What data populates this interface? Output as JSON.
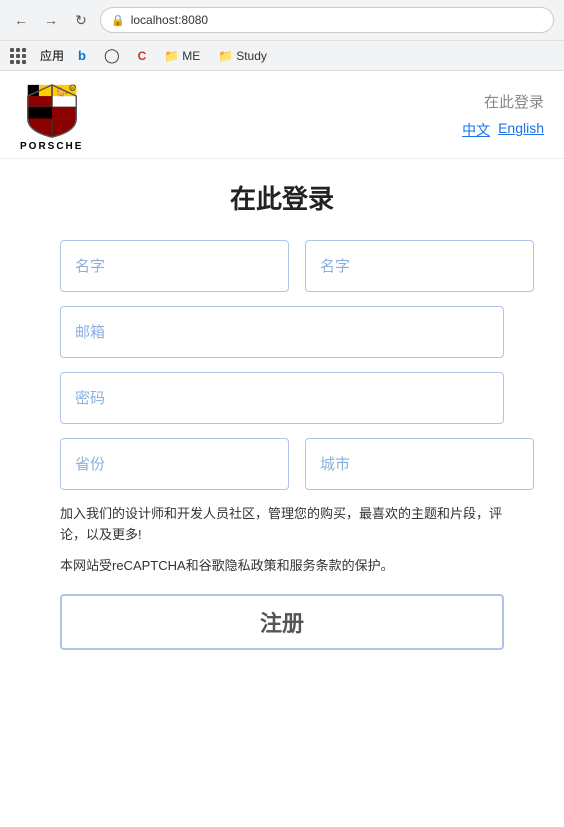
{
  "browser": {
    "back_icon": "←",
    "forward_icon": "→",
    "refresh_icon": "↻",
    "url": "localhost:8080",
    "url_icon": "🔒",
    "bookmarks": [
      {
        "id": "apps",
        "label": "应用",
        "icon": "⊞"
      },
      {
        "id": "bing",
        "label": "",
        "icon": "b",
        "color": "#0078d4"
      },
      {
        "id": "github",
        "label": "",
        "icon": "◉"
      },
      {
        "id": "codepen",
        "label": "",
        "icon": "C",
        "color": "#cc3333"
      },
      {
        "id": "me",
        "label": "ME",
        "icon": "🔖"
      },
      {
        "id": "study",
        "label": "Study",
        "icon": "🔖"
      }
    ]
  },
  "header": {
    "login_link": "在此登录",
    "lang_chinese": "中文",
    "lang_english": "English",
    "porsche_wordmark": "PORSCHE"
  },
  "form": {
    "title": "在此登录",
    "firstname_placeholder": "名字",
    "lastname_placeholder": "名字",
    "email_placeholder": "邮箱",
    "password_placeholder": "密码",
    "province_placeholder": "省份",
    "city_placeholder": "城市",
    "description1": "加入我们的设计师和开发人员社区，管理您的购买，最喜欢的主题和片段，评论，以及更多!",
    "description2": "本网站受reCAPTCHA和谷歌隐私政策和服务条款的保护。",
    "submit_label": "注册"
  }
}
